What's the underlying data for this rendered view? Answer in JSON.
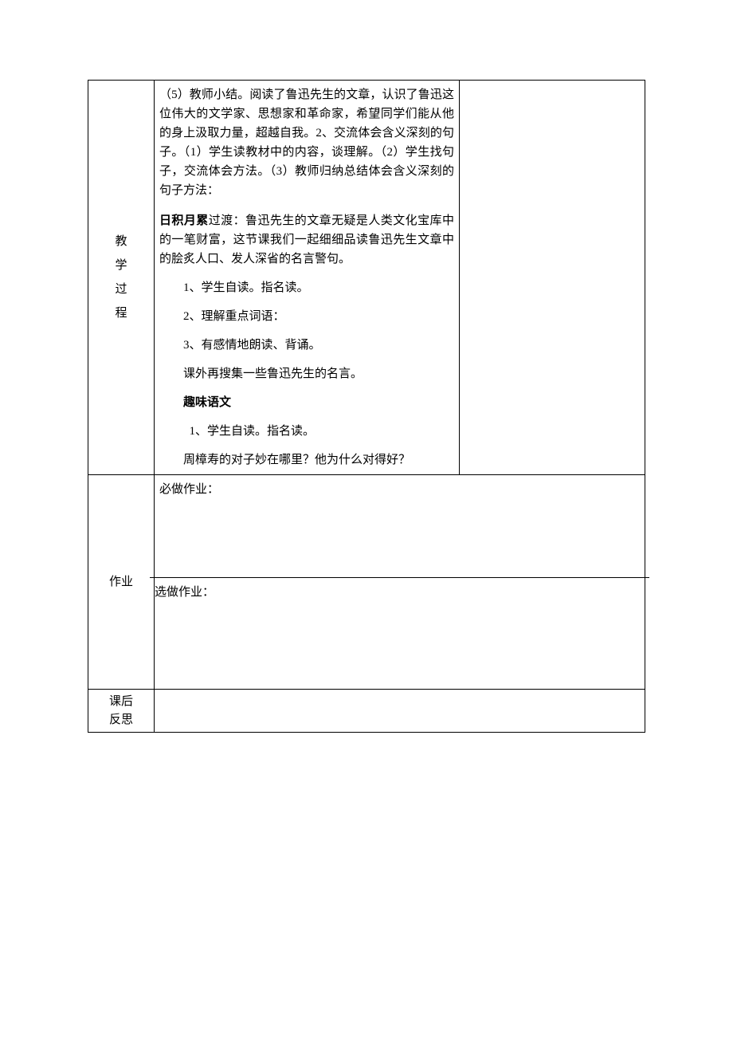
{
  "labels": {
    "process_v1": "教",
    "process_v2": "学",
    "process_v3": "过",
    "process_v4": "程",
    "homework": "作业",
    "reflection_v1": "课后",
    "reflection_v2": "反思"
  },
  "process": {
    "p1": "（5）教师小结。阅读了鲁迅先生的文章，认识了鲁迅这位伟大的文学家、思想家和革命家，希望同学们能从他的身上汲取力量，超越自我。2、交流体会含义深刻的句子。（1）学生读教材中的内容，谈理解。（2）学生找句子，交流体会方法。（3）教师归纳总结体会含义深刻的句子方法：",
    "accum_label": "日积月累",
    "accum_text": "过渡：鲁迅先生的文章无疑是人类文化宝库中的一笔财富，这节课我们一起细细品读鲁迅先生文章中的脍炙人口、发人深省的名言警句。",
    "li1": "1、学生自读。指名读。",
    "li2": "2、理解重点词语：",
    "li3": "3、有感情地朗读、背诵。",
    "extra": "课外再搜集一些鲁迅先生的名言。",
    "fun_heading": "趣味语文",
    "fun1": "1、学生自读。指名读。",
    "fun2": "周樟寿的对子妙在哪里？他为什么对得好？"
  },
  "homework": {
    "required": "必做作业：",
    "optional": "选做作业："
  }
}
